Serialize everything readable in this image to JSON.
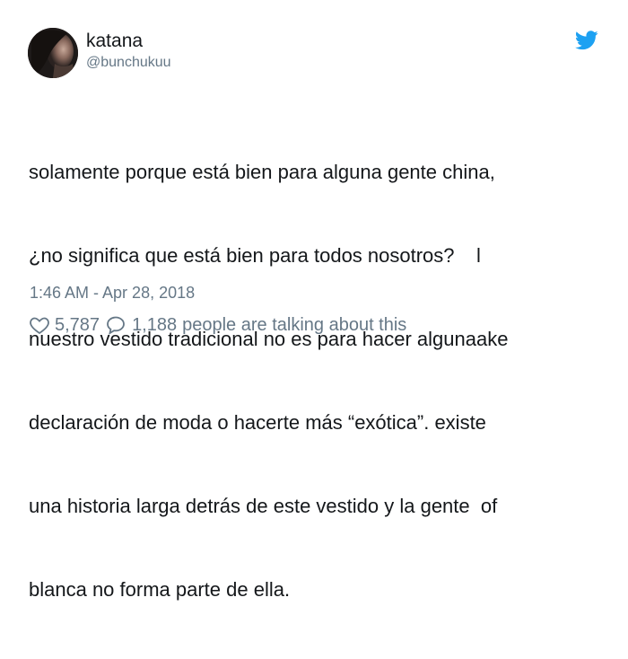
{
  "author": {
    "name": "katana",
    "handle": "@bunchukuu"
  },
  "icons": {
    "platform": "twitter-bird-icon",
    "like": "heart-icon",
    "reply": "speech-bubble-icon"
  },
  "colors": {
    "brand": "#1da1f2",
    "text": "#14171a",
    "muted": "#657786"
  },
  "tweet": {
    "lines": [
      "solamente porque está bien para alguna gente china,",
      "¿no significa que está bien para todos nosotros?    l",
      "nuestro vestido tradicional no es para hacer algunaake",
      "declaración de moda o hacerte más “exótica”. existe",
      "una historia larga detrás de este vestido y la gente  of",
      "blanca no forma parte de ella."
    ],
    "timestamp": "1:46 AM - Apr 28, 2018"
  },
  "engagement": {
    "likes": "5,787",
    "replies": "1,188",
    "talking_label": "people are talking about this"
  }
}
